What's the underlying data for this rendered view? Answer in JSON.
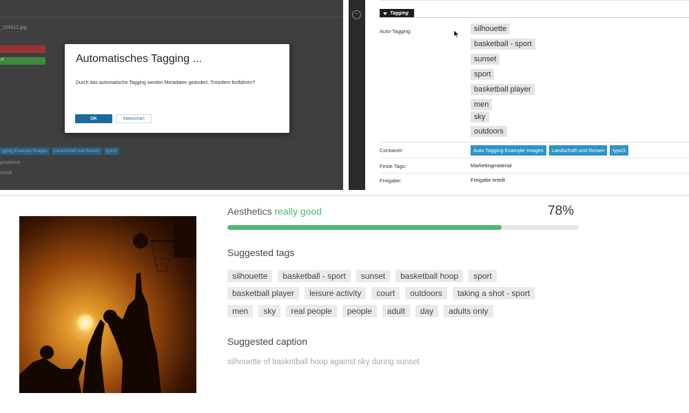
{
  "backend": {
    "filename": "_150812.jpg",
    "green_button_label": "el",
    "container_tags": [
      "gging Example Images",
      "Landschaft und Reisen",
      "typo3"
    ],
    "fixed_tags_value": "gmaterial",
    "release_value": "erteilt"
  },
  "modal": {
    "title": "Automatisches Tagging ...",
    "message": "Durch das automatische Tagging werden Metadaten geändert. Trotzdem fortfahren?",
    "ok_label": "OK",
    "cancel_label": "Abbrechen"
  },
  "metadata": {
    "section_title": "Tagging",
    "auto_tagging_label": "Auto-Tagging:",
    "auto_tags": [
      "silhouette",
      "basketball - sport",
      "sunset",
      "sport",
      "basketball player",
      "men",
      "sky",
      "outdoors"
    ],
    "container_label": "Container:",
    "container_tags": [
      "Auto Tagging Example Images",
      "Landschaft und Reisen",
      "typo3"
    ],
    "fixed_tags_label": "Feste Tags:",
    "fixed_tags_value": "Marketingmaterial",
    "release_label": "Freigabe:",
    "release_value": "Freigabe erteilt"
  },
  "analysis": {
    "aesthetics_label": "Aesthetics",
    "aesthetics_value": "really good",
    "aesthetics_percent_text": "78%",
    "aesthetics_score": 0.78,
    "suggested_tags_heading": "Suggested tags",
    "suggested_tags": [
      [
        "silhouette",
        "basketball - sport",
        "sunset",
        "basketball hoop",
        "sport"
      ],
      [
        "basketball player",
        "leisure activity",
        "court",
        "outdoors",
        "taking a shot - sport"
      ],
      [
        "men",
        "sky",
        "real people",
        "people",
        "adult",
        "day",
        "adults only"
      ]
    ],
    "suggested_caption_heading": "Suggested caption",
    "suggested_caption": "silhouette of basketball hoop against sky during sunset"
  },
  "colors": {
    "accent_green": "#4fb96f",
    "tag_blue": "#2d93c9",
    "ok_blue": "#1d6a9d"
  }
}
